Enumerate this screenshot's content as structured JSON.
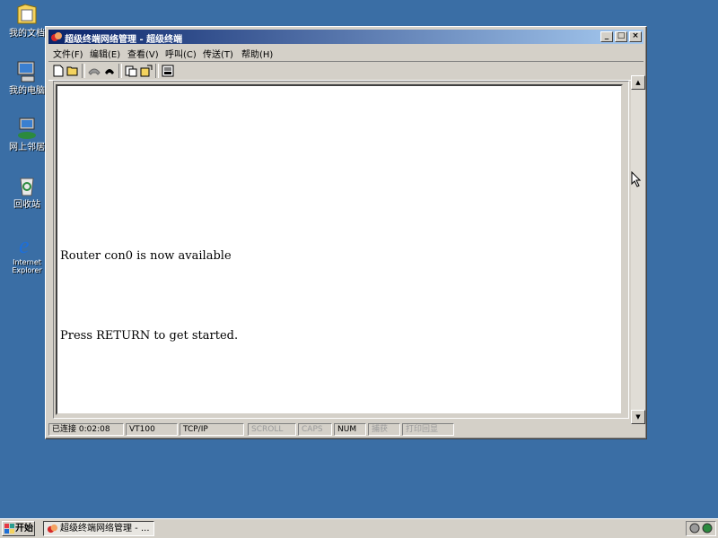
{
  "desktop": {
    "icons": [
      {
        "label": "我的文档",
        "icon": "my-documents-icon"
      },
      {
        "label": "我的电脑",
        "icon": "my-computer-icon"
      },
      {
        "label": "网上邻居",
        "icon": "network-places-icon"
      },
      {
        "label": "回收站",
        "icon": "recycle-bin-icon"
      },
      {
        "label": "Internet Explorer",
        "icon": "internet-explorer-icon"
      }
    ]
  },
  "window": {
    "title": "超级终端网络管理 - 超级终端",
    "buttons": {
      "minimize": "_",
      "maximize": "□",
      "close": "×"
    },
    "menu": [
      "文件(F)",
      "编辑(E)",
      "查看(V)",
      "呼叫(C)",
      "传送(T)",
      "帮助(H)"
    ],
    "toolbar": [
      "new-connection-icon",
      "open-icon",
      "disconnect-icon",
      "dial-icon",
      "send-file-icon",
      "receive-file-icon",
      "properties-icon"
    ],
    "terminal_lines": [
      "Router con0 is now available",
      "Press RETURN to get started."
    ],
    "status": {
      "connected": "已连接 0:02:08",
      "emulation": "VT100",
      "protocol": "TCP/IP",
      "scroll": "SCROLL",
      "caps": "CAPS",
      "num": "NUM",
      "capture": "捕获",
      "print_echo": "打印回显"
    }
  },
  "taskbar": {
    "start_label": "开始",
    "task_label": "超级终端网络管理 - ..."
  },
  "colors": {
    "desktop": "#3a6ea5",
    "titlebar_start": "#0a246a",
    "titlebar_end": "#a6caf0"
  }
}
